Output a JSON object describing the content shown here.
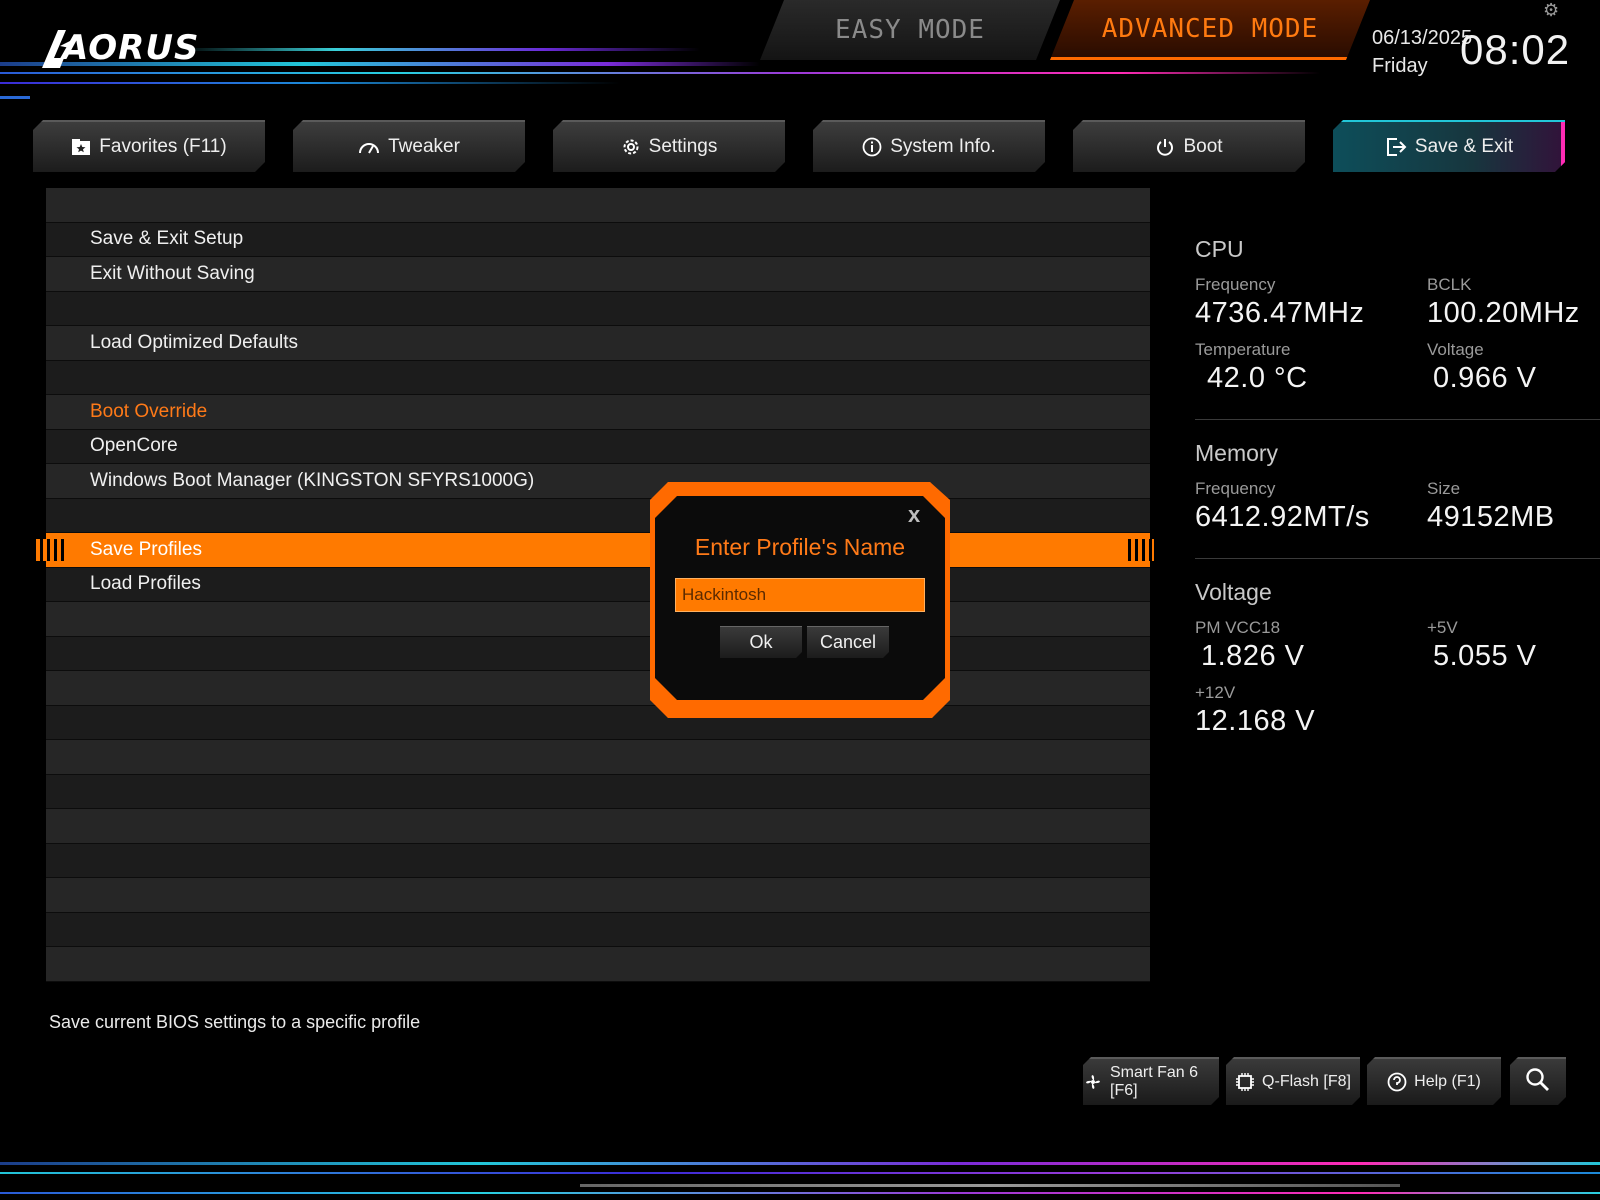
{
  "header": {
    "logo": "AORUS",
    "easy_mode": "EASY MODE",
    "advanced_mode": "ADVANCED MODE",
    "date": "06/13/2025",
    "weekday": "Friday",
    "time": "08:02"
  },
  "nav": {
    "tabs": [
      {
        "label": "Favorites (F11)",
        "icon": "star-folder-icon"
      },
      {
        "label": "Tweaker",
        "icon": "speedometer-icon"
      },
      {
        "label": "Settings",
        "icon": "gear-icon"
      },
      {
        "label": "System Info.",
        "icon": "info-icon"
      },
      {
        "label": "Boot",
        "icon": "power-icon"
      },
      {
        "label": "Save & Exit",
        "icon": "exit-icon",
        "active": true
      }
    ]
  },
  "menu": {
    "items": [
      "",
      "Save & Exit Setup",
      "Exit Without Saving",
      "",
      "Load Optimized Defaults",
      "",
      "Boot Override",
      "OpenCore",
      "Windows Boot Manager (KINGSTON SFYRS1000G)",
      "",
      "Save Profiles",
      "Load Profiles",
      "",
      "",
      "",
      "",
      "",
      "",
      "",
      "",
      "",
      "",
      ""
    ],
    "selected_index": 10,
    "highlight_index": 6,
    "description": "Save current BIOS settings to a specific profile"
  },
  "info": {
    "cpu": {
      "title": "CPU",
      "frequency_label": "Frequency",
      "frequency": "4736.47MHz",
      "bclk_label": "BCLK",
      "bclk": "100.20MHz",
      "temp_label": "Temperature",
      "temp": "42.0 °C",
      "voltage_label": "Voltage",
      "voltage": "0.966 V"
    },
    "memory": {
      "title": "Memory",
      "frequency_label": "Frequency",
      "frequency": "6412.92MT/s",
      "size_label": "Size",
      "size": "49152MB"
    },
    "voltage": {
      "title": "Voltage",
      "pmvcc18_label": "PM VCC18",
      "pmvcc18": "1.826 V",
      "p5v_label": "+5V",
      "p5v": "5.055 V",
      "p12v_label": "+12V",
      "p12v": "12.168 V"
    }
  },
  "dialog": {
    "close": "x",
    "title": "Enter Profile's Name",
    "input_value": "Hackintosh",
    "ok": "Ok",
    "cancel": "Cancel"
  },
  "footer": {
    "smart_fan": "Smart Fan 6 [F6]",
    "qflash": "Q-Flash [F8]",
    "help": "Help (F1)"
  },
  "colors": {
    "accent": "#ff7a00",
    "active_tab": "#22c6d8",
    "active_tab_edge": "#ff2bb5"
  }
}
